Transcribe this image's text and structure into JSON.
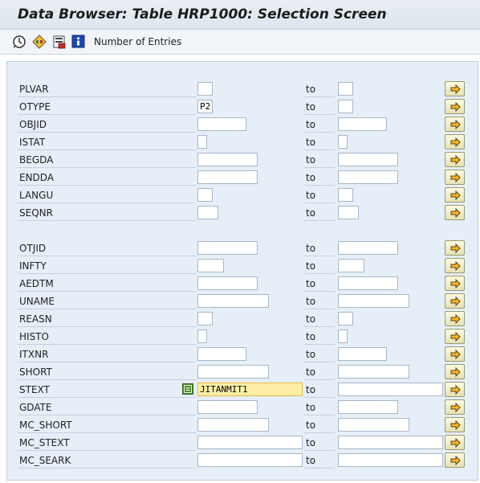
{
  "window": {
    "title": "Data Browser: Table HRP1000: Selection Screen"
  },
  "toolbar": {
    "execute_icon": "execute-clock-icon",
    "variant_icon": "get-variant-icon",
    "save_icon": "save-variant-icon",
    "info_icon": "information-icon",
    "entries_label": "Number of Entries"
  },
  "to_label": "to",
  "fields": [
    {
      "name": "PLVAR",
      "low": "",
      "high": ""
    },
    {
      "name": "OTYPE",
      "low": "P2",
      "high": ""
    },
    {
      "name": "OBJID",
      "low": "",
      "high": ""
    },
    {
      "name": "ISTAT",
      "low": "",
      "high": ""
    },
    {
      "name": "BEGDA",
      "low": "",
      "high": ""
    },
    {
      "name": "ENDDA",
      "low": "",
      "high": ""
    },
    {
      "name": "LANGU",
      "low": "",
      "high": ""
    },
    {
      "name": "SEQNR",
      "low": "",
      "high": ""
    },
    {
      "name": "OTJID",
      "low": "",
      "high": ""
    },
    {
      "name": "INFTY",
      "low": "",
      "high": ""
    },
    {
      "name": "AEDTM",
      "low": "",
      "high": ""
    },
    {
      "name": "UNAME",
      "low": "",
      "high": ""
    },
    {
      "name": "REASN",
      "low": "",
      "high": ""
    },
    {
      "name": "HISTO",
      "low": "",
      "high": ""
    },
    {
      "name": "ITXNR",
      "low": "",
      "high": ""
    },
    {
      "name": "SHORT",
      "low": "",
      "high": ""
    },
    {
      "name": "STEXT",
      "low": "JITANMIT1",
      "high": "",
      "active": true,
      "selection_option_icon": "equals-option-icon"
    },
    {
      "name": "GDATE",
      "low": "",
      "high": ""
    },
    {
      "name": "MC_SHORT",
      "low": "",
      "high": ""
    },
    {
      "name": "MC_STEXT",
      "low": "",
      "high": ""
    },
    {
      "name": "MC_SEARK",
      "low": "",
      "high": ""
    }
  ],
  "multiple_selection_icon": "arrow-right-icon",
  "colors": {
    "panel_bg": "#e6eef7",
    "active_field_bg": "#ffefa6",
    "focus_bracket": "#d03030",
    "button_arrow": "#e0a020"
  }
}
